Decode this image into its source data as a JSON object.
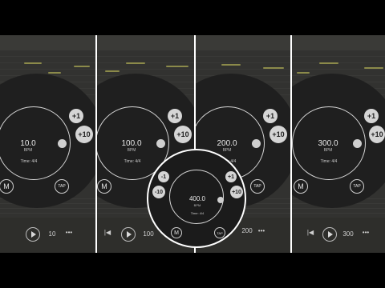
{
  "panels": [
    {
      "bpm": "10.0",
      "bpm_label": "BPM",
      "time": "Time: 4/4",
      "plus1": "+1",
      "plus10": "+10",
      "m": "M",
      "tap": "TAP",
      "bottom_value": "10"
    },
    {
      "bpm": "100.0",
      "bpm_label": "BPM",
      "time": "Time: 4/4",
      "plus1": "+1",
      "plus10": "+10",
      "m": "M",
      "tap": "TAP",
      "bottom_value": "100"
    },
    {
      "bpm": "200.0",
      "bpm_label": "BPM",
      "time": "Time: 4/4",
      "plus1": "+1",
      "plus10": "+10",
      "m": "M",
      "tap": "TAP",
      "bottom_value": "200"
    },
    {
      "bpm": "300.0",
      "bpm_label": "BPM",
      "time": "Time: 4/4",
      "plus1": "+1",
      "plus10": "+10",
      "m": "M",
      "tap": "TAP",
      "bottom_value": "300"
    }
  ],
  "zoom": {
    "bpm": "400.0",
    "bpm_label": "BPM",
    "time": "Time: 4/4",
    "minus1": "-1",
    "minus10": "-10",
    "plus1": "+1",
    "plus10": "+10",
    "m": "M",
    "tap": "TAP"
  },
  "icons": {
    "play": "play-icon",
    "dots": "more-dots-icon",
    "prev": "skip-back-icon"
  },
  "colors": {
    "dial_bg": "#1f1f1f",
    "ring": "#d7d7d7",
    "button": "#d5d5d5",
    "dash": "#8b8a4a"
  }
}
